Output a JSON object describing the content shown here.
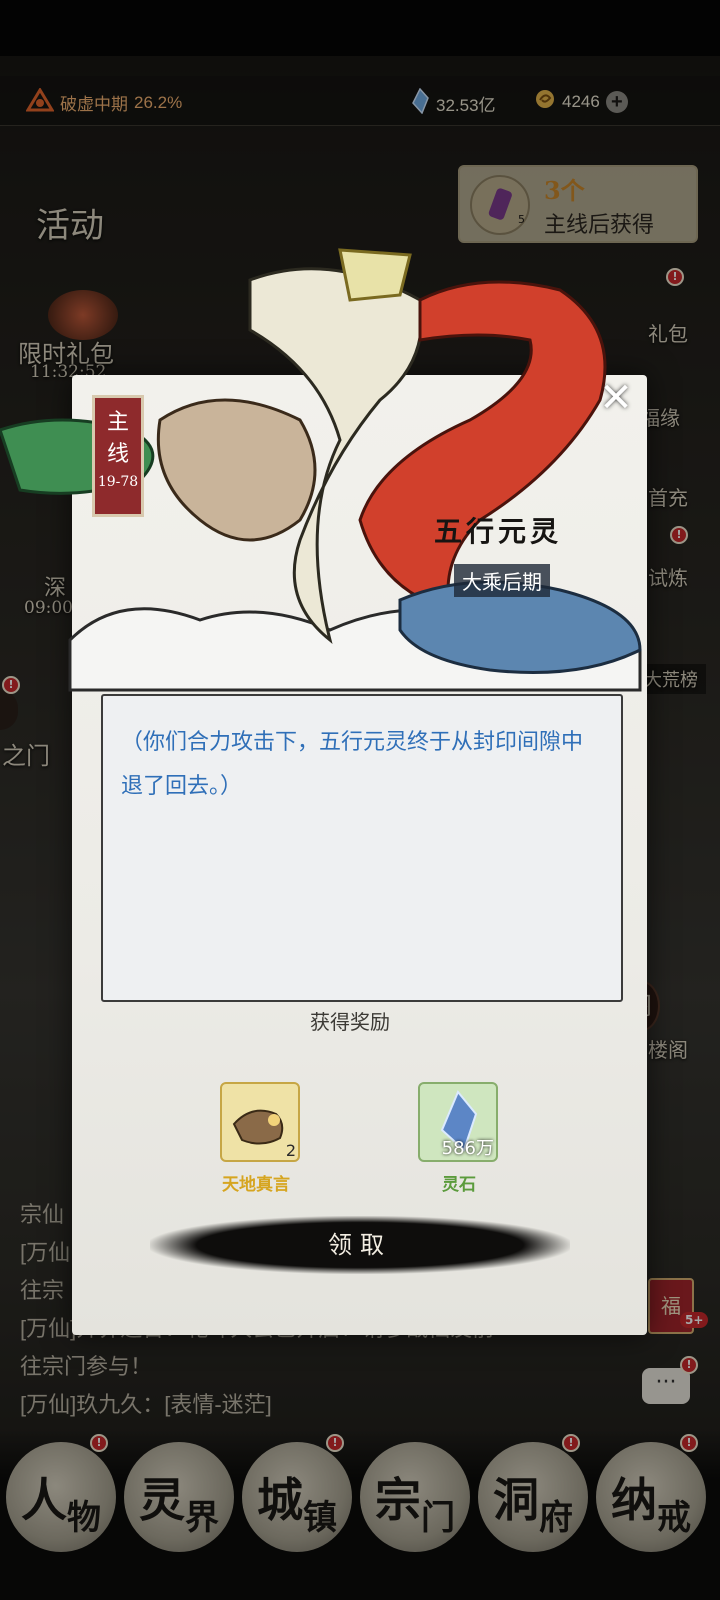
{
  "top_bar": {
    "realm": "破虚中期",
    "progress": "26.2%",
    "spirit_stones": "32.53亿",
    "currency": "4246"
  },
  "side_left": {
    "activity": "活动",
    "limited_gift": "限时礼包",
    "limited_timer": "11:32:52",
    "deep_label": "深",
    "deep_timer": "09:00",
    "gate_label": "之门"
  },
  "promo": {
    "count": "3个",
    "text": "主线后获得",
    "item_count": "5"
  },
  "side_right": {
    "gift": "礼包",
    "fortune": "福缘",
    "recharge": "首充",
    "trial": "试炼",
    "ranking": "大荒榜",
    "pavilion": "阁",
    "pavilion2": "楼阁",
    "fu": "福",
    "fu_badge": "5+"
  },
  "chat": {
    "lines": [
      "宗仙",
      "[万仙",
      "往宗",
      "[万仙]异界通告：乾坤大会已开启！请参战仙友前",
      "往宗门参与！",
      "[万仙]玖九久：[表情-迷茫]"
    ]
  },
  "nav": {
    "items": [
      {
        "a": "人",
        "b": "物"
      },
      {
        "a": "灵",
        "b": "界"
      },
      {
        "a": "城",
        "b": "镇"
      },
      {
        "a": "宗",
        "b": "门"
      },
      {
        "a": "洞",
        "b": "府"
      },
      {
        "a": "纳",
        "b": "戒"
      }
    ],
    "badge": "!"
  },
  "modal": {
    "tag_line1": "主",
    "tag_line2": "线",
    "tag_range": "19-78",
    "boss_name": "五行元灵",
    "boss_level": "大乘后期",
    "dialog": "（你们合力攻击下，五行元灵终于从封印间隙中退了回去。）",
    "reward_title": "获得奖励",
    "rewards": [
      {
        "name": "天地真言",
        "qty": "2",
        "color": "#d6a520"
      },
      {
        "name": "灵石",
        "qty": "586万",
        "color": "#5b9b3c"
      }
    ],
    "claim": "领取"
  }
}
